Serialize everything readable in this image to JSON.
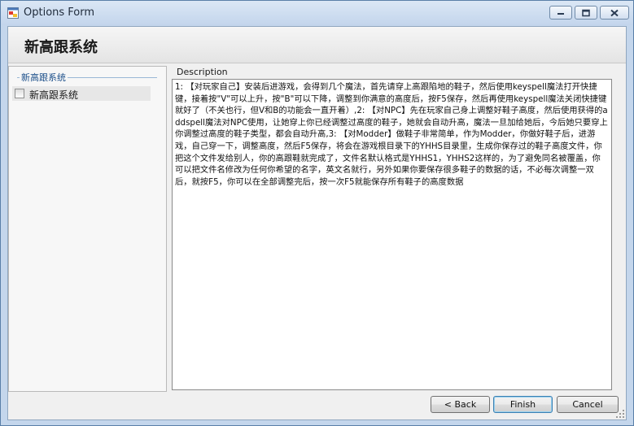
{
  "window": {
    "title": "Options Form"
  },
  "header": {
    "title": "新高跟系统"
  },
  "options_group": {
    "label": "新高跟系统",
    "items": [
      {
        "label": "新高跟系统",
        "checked": false
      }
    ]
  },
  "description": {
    "label": "Description",
    "text": "1: 【对玩家自己】安装后进游戏，会得到几个魔法，首先请穿上高跟陷地的鞋子，然后使用keyspell魔法打开快捷键，接着按\"V\"可以上升，按\"B\"可以下降，调整到你满意的高度后，按F5保存，然后再使用keyspell魔法关闭快捷键就好了（不关也行，但V和B的功能会一直开着）,2: 【对NPC】先在玩家自己身上调整好鞋子高度，然后使用获得的addspell魔法对NPC使用，让她穿上你已经调整过高度的鞋子，她就会自动升高，魔法一旦加给她后，今后她只要穿上你调整过高度的鞋子类型，都会自动升高,3: 【对Modder】做鞋子非常简单，作为Modder，你做好鞋子后，进游戏，自己穿一下，调整高度，然后F5保存，将会在游戏根目录下的YHHS目录里，生成你保存过的鞋子高度文件，你把这个文件发给别人，你的高跟鞋就完成了，文件名默认格式是YHHS1，YHHS2这样的，为了避免同名被覆盖，你可以把文件名修改为任何你希望的名字，英文名就行，另外如果你要保存很多鞋子的数据的话，不必每次调整一双后，就按F5，你可以在全部调整完后，按一次F5就能保存所有鞋子的高度数据"
  },
  "buttons": {
    "back": "< Back",
    "finish": "Finish",
    "cancel": "Cancel"
  },
  "colors": {
    "title_bar": "#c3d5ec",
    "group_label": "#1c4f8a",
    "finish_border": "#3c7fb1"
  },
  "icons": {
    "app": "form-app-icon",
    "minimize": "minimize-icon",
    "maximize": "maximize-icon",
    "close": "close-icon"
  }
}
